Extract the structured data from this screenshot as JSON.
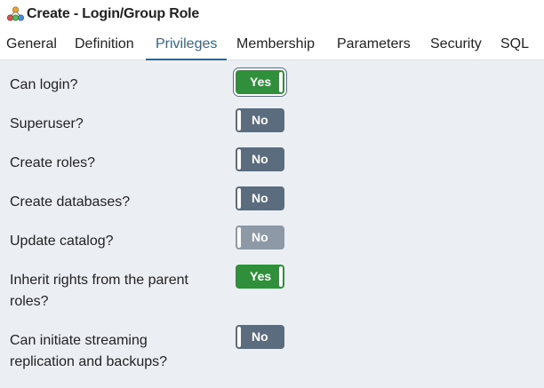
{
  "window": {
    "title": "Create - Login/Group Role",
    "icon": "group-role-icon"
  },
  "tabs": [
    {
      "label": "General"
    },
    {
      "label": "Definition"
    },
    {
      "label": "Privileges",
      "active": true
    },
    {
      "label": "Membership"
    },
    {
      "label": "Parameters"
    },
    {
      "label": "Security"
    },
    {
      "label": "SQL"
    }
  ],
  "privileges": [
    {
      "label": "Can login?",
      "value": "Yes",
      "state": "on"
    },
    {
      "label": "Superuser?",
      "value": "No",
      "state": "off"
    },
    {
      "label": "Create roles?",
      "value": "No",
      "state": "off"
    },
    {
      "label": "Create databases?",
      "value": "No",
      "state": "off"
    },
    {
      "label": "Update catalog?",
      "value": "No",
      "state": "disabled"
    },
    {
      "label_line1": "Inherit rights from the parent",
      "label_line2": "roles?",
      "value": "Yes",
      "state": "on"
    },
    {
      "label_line1": "Can initiate streaming",
      "label_line2": "replication and backups?",
      "value": "No",
      "state": "off"
    }
  ],
  "colors": {
    "toggle_on": "#2f8f3b",
    "toggle_off": "#5b6c7e",
    "toggle_disabled": "#8d99a6",
    "active_tab": "#326690"
  }
}
